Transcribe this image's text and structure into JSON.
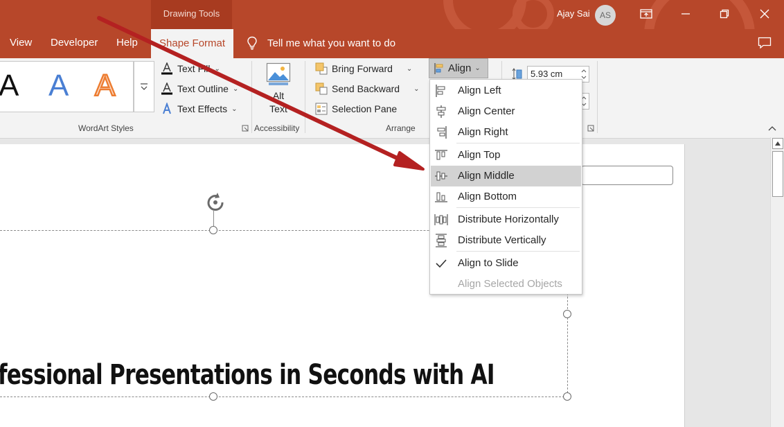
{
  "titlebar": {
    "context_tab": "Drawing Tools",
    "user_name": "Ajay Sai",
    "avatar_initials": "AS"
  },
  "menubar": {
    "tabs": [
      "View",
      "Developer",
      "Help"
    ],
    "active_tab": "Shape Format",
    "tell_me": "Tell me what you want to do"
  },
  "wordart": {
    "letter": "A",
    "text_fill": "Text Fill",
    "text_outline": "Text Outline",
    "text_effects": "Text Effects",
    "group_label": "WordArt Styles"
  },
  "accessibility": {
    "alt_text_line1": "Alt",
    "alt_text_line2": "Text",
    "group_label": "Accessibility"
  },
  "arrange": {
    "bring_forward": "Bring Forward",
    "send_backward": "Send Backward",
    "selection_pane": "Selection Pane",
    "align": "Align",
    "group_label": "Arrange"
  },
  "size": {
    "height_value": "5.93 cm"
  },
  "align_menu": {
    "items": [
      {
        "label": "Align Left",
        "state": "normal"
      },
      {
        "label": "Align Center",
        "state": "normal"
      },
      {
        "label": "Align Right",
        "state": "normal"
      },
      {
        "label": "Align Top",
        "state": "normal"
      },
      {
        "label": "Align Middle",
        "state": "hover"
      },
      {
        "label": "Align Bottom",
        "state": "normal"
      },
      {
        "label": "Distribute Horizontally",
        "state": "normal"
      },
      {
        "label": "Distribute Vertically",
        "state": "normal"
      },
      {
        "label": "Align to Slide",
        "state": "checked"
      },
      {
        "label": "Align Selected Objects",
        "state": "disabled"
      }
    ]
  },
  "slide": {
    "title_text": "fessional Presentations in Seconds with AI"
  },
  "colors": {
    "brand": "#b7472a",
    "annotation_arrow": "#b42121",
    "hover": "#d2d2d2"
  }
}
